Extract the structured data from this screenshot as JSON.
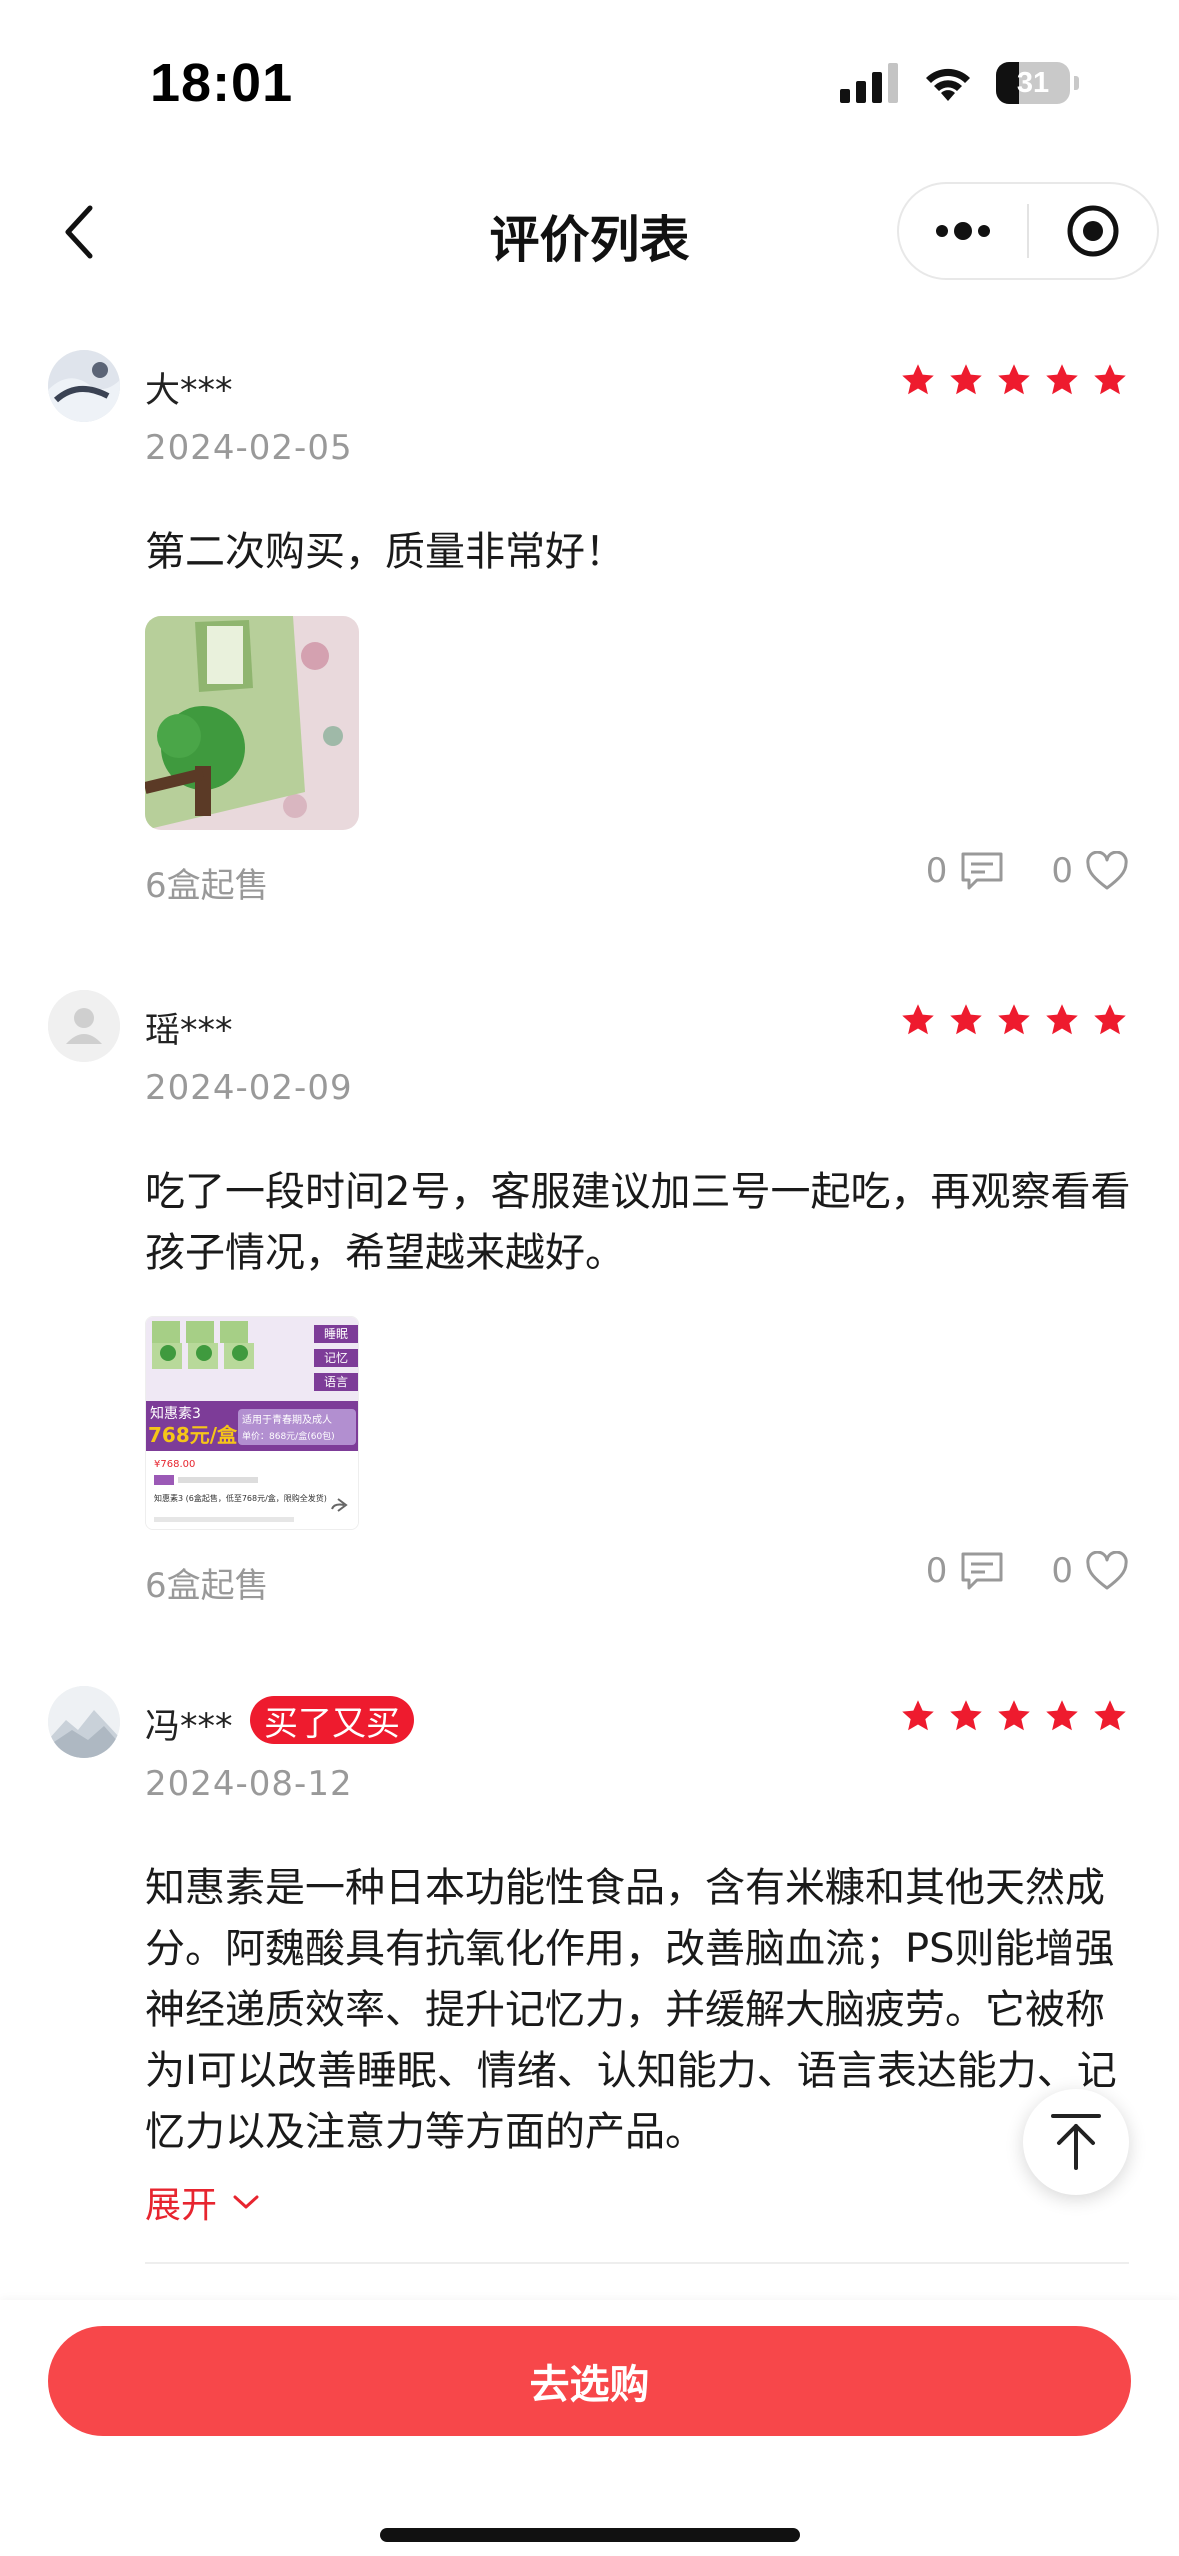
{
  "status_bar": {
    "time": "18:01",
    "battery": "31",
    "battery_level": 0.31
  },
  "nav": {
    "title": "评价列表"
  },
  "icons": {
    "back": "chevron-left-icon",
    "more": "more-dots-icon",
    "target": "record-target-icon",
    "comment": "comment-icon",
    "like": "heart-icon",
    "star": "star-icon",
    "expand": "chevron-down-icon",
    "top": "arrow-up-top-icon"
  },
  "colors": {
    "accent": "#e7252f",
    "star": "#ee1b2e",
    "cta": "#f7474a",
    "muted": "#999999"
  },
  "reviews": [
    {
      "username": "大***",
      "date": "2024-02-05",
      "rating": 5,
      "text": "第二次购买，质量非常好！",
      "sale_label": "6盒起售",
      "comments": "0",
      "likes": "0"
    },
    {
      "username": "瑶***",
      "date": "2024-02-09",
      "rating": 5,
      "text": "吃了一段时间2号，客服建议加三号一起吃，再观察看看孩子情况，希望越来越好。",
      "image": {
        "tags": [
          "睡眠",
          "记忆",
          "语言"
        ],
        "product": "知惠素3",
        "price": "768元/盒",
        "subtitle": "适用于青春期及成人",
        "sub_price": "单价：868元/盒(60包)",
        "old_price": "¥768.00",
        "caption": "知惠素3 (6盒起售，低至768元/盒，限购全发货)"
      },
      "sale_label": "6盒起售",
      "comments": "0",
      "likes": "0"
    },
    {
      "username": "冯***",
      "badge": "买了又买",
      "date": "2024-08-12",
      "rating": 5,
      "text": "知惠素是一种日本功能性食品，含有米糠和其他天然成分。阿魏酸具有抗氧化作用，改善脑血流；PS则能增强神经递质效率、提升记忆力，并缓解大脑疲劳。它被称为I可以改善睡眠、情绪、认知能力、语言表达能力、记忆力以及注意力等方面的产品。",
      "expand_label": "展开"
    }
  ],
  "cta": {
    "label": "去选购"
  }
}
